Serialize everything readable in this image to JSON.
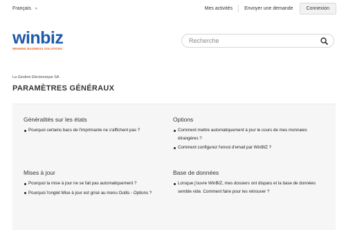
{
  "topbar": {
    "language": "Français",
    "links": [
      "Mes activités",
      "Envoyer une demande"
    ],
    "login_label": "Connexion"
  },
  "logo": {
    "word": "winbiz",
    "tagline": "WINNING BUSINESS SOLUTIONS"
  },
  "search": {
    "placeholder": "Recherche"
  },
  "breadcrumb": "La Gestion Electronique SA",
  "page_title": "PARAMÈTRES GÉNÉRAUX",
  "sections": [
    {
      "title": "Généralités sur les états",
      "items": [
        "Pourquoi certains bacs de l'imprimante ne s'affichent pas ?"
      ]
    },
    {
      "title": "Options",
      "items": [
        "Comment mettre automatiquement à jour le cours de mes monnaies étrangères ?",
        "Comment configurez l'envoi d'email par WinBIZ ?"
      ]
    },
    {
      "title": "Mises à jour",
      "items": [
        "Pourquoi la mise à jour ne se fait pas automatiquement ?",
        "Pourquoi l'onglet Mise à jour est grisé au menu Outils - Options ?"
      ]
    },
    {
      "title": "Base de données",
      "items": [
        "Lorsque j'ouvre WinBIZ, mes dossiers ont disparu et la base de données semble vide. Comment faire pour les retrouver ?"
      ]
    }
  ],
  "colors": {
    "brand_blue": "#1f5aa8",
    "brand_orange": "#e8601c"
  }
}
